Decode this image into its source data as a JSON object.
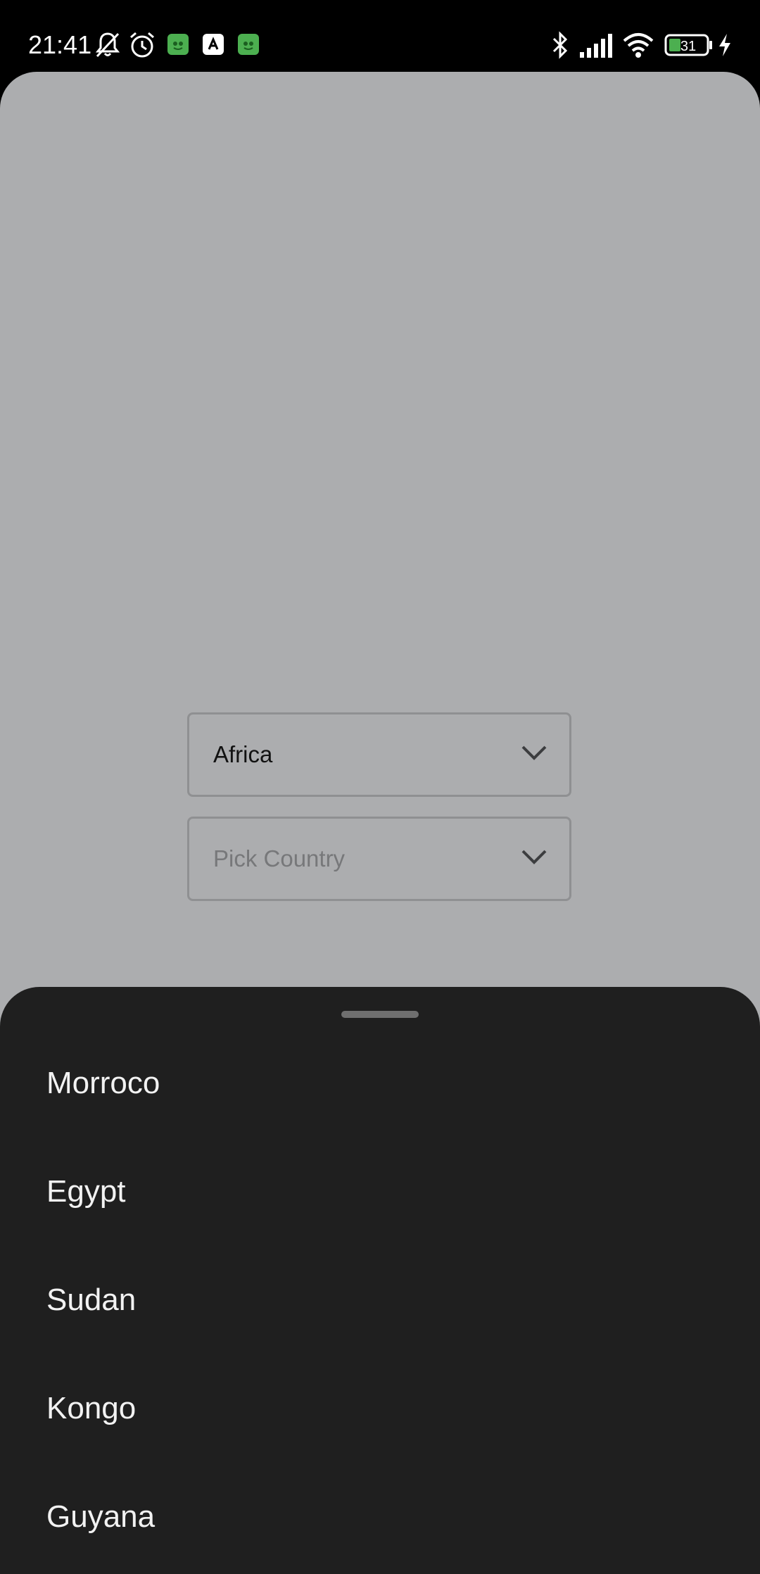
{
  "status_bar": {
    "time": "21:41",
    "battery_level": "31",
    "left_icons": [
      "notifications-off-icon",
      "alarm-icon",
      "app-notification-icon",
      "app-notification-icon",
      "app-notification-icon"
    ],
    "right_icons": [
      "bluetooth-icon",
      "cellular-signal-icon",
      "wifi-icon",
      "battery-icon",
      "charging-icon"
    ]
  },
  "form": {
    "continent_dropdown": {
      "value": "Africa",
      "icon": "chevron-down-icon"
    },
    "country_dropdown": {
      "placeholder": "Pick Country",
      "icon": "chevron-down-icon"
    }
  },
  "bottom_sheet": {
    "options": [
      "Morroco",
      "Egypt",
      "Sudan",
      "Kongo",
      "Guyana"
    ]
  },
  "colors": {
    "scrimmed_background": "#acadaf",
    "sheet_background": "#1f1f1f",
    "app_icon_green": "#4caf50"
  }
}
